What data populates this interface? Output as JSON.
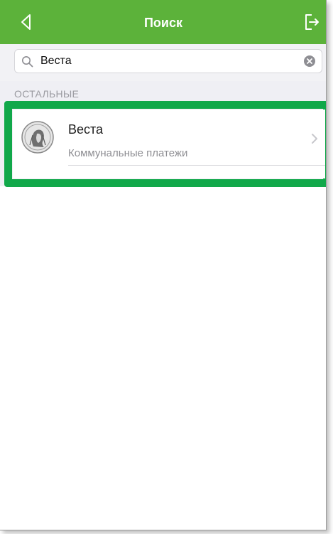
{
  "navbar": {
    "title": "Поиск",
    "back_icon": "back-chevron-icon",
    "exit_icon": "logout-icon",
    "color": "#5cb23a"
  },
  "search": {
    "value": "Веста",
    "icon": "search-icon",
    "clear_icon": "clear-icon"
  },
  "section": {
    "header": "ОСТАЛЬНЫЕ"
  },
  "results": [
    {
      "title": "Веста",
      "subtitle": "Коммунальные платежи",
      "icon": "vesta-coin-avatar"
    }
  ],
  "highlight_color": "#11a84a"
}
